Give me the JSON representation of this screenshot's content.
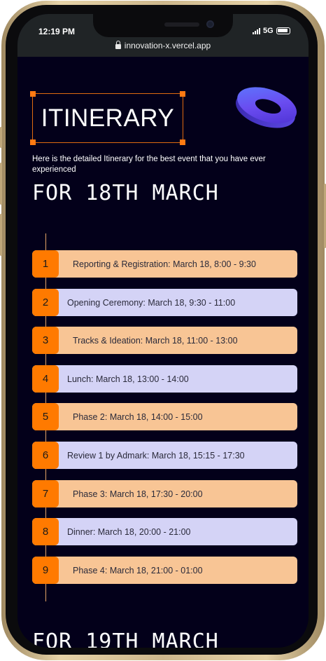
{
  "status_bar": {
    "time": "12:19 PM",
    "network": "5G"
  },
  "browser": {
    "url": "innovation-x.vercel.app"
  },
  "page": {
    "title": "ITINERARY",
    "subtitle": "Here is the detailed Itinerary for the best event that you have ever experienced",
    "day1_heading": "FOR 18TH MARCH",
    "day2_heading": "FOR 19TH MARCH"
  },
  "itinerary": [
    {
      "number": "1",
      "text": "Reporting & Registration: March 18, 8:00 - 9:30",
      "color": "#f8c595"
    },
    {
      "number": "2",
      "text": "Opening Ceremony: March 18, 9:30 - 11:00",
      "color": "#d4d3f6"
    },
    {
      "number": "3",
      "text": "Tracks & Ideation: March 18, 11:00 - 13:00",
      "color": "#f8c595"
    },
    {
      "number": "4",
      "text": "Lunch: March 18, 13:00 - 14:00",
      "color": "#d4d3f6"
    },
    {
      "number": "5",
      "text": "Phase 2: March 18, 14:00 - 15:00",
      "color": "#f8c595"
    },
    {
      "number": "6",
      "text": "Review 1 by Admark: March 18, 15:15 - 17:30",
      "color": "#d4d3f6"
    },
    {
      "number": "7",
      "text": "Phase 3: March 18, 17:30 - 20:00",
      "color": "#f8c595"
    },
    {
      "number": "8",
      "text": "Dinner: March 18, 20:00 - 21:00",
      "color": "#d4d3f6"
    },
    {
      "number": "9",
      "text": "Phase 4: March 18, 21:00 - 01:00",
      "color": "#f8c595"
    }
  ],
  "colors": {
    "background": "#03001a",
    "accent": "#ff7a00",
    "card_peach": "#f8c595",
    "card_lavender": "#d4d3f6"
  },
  "icons": [
    "lock-icon",
    "signal-icon",
    "battery-icon",
    "torus-graphic"
  ]
}
